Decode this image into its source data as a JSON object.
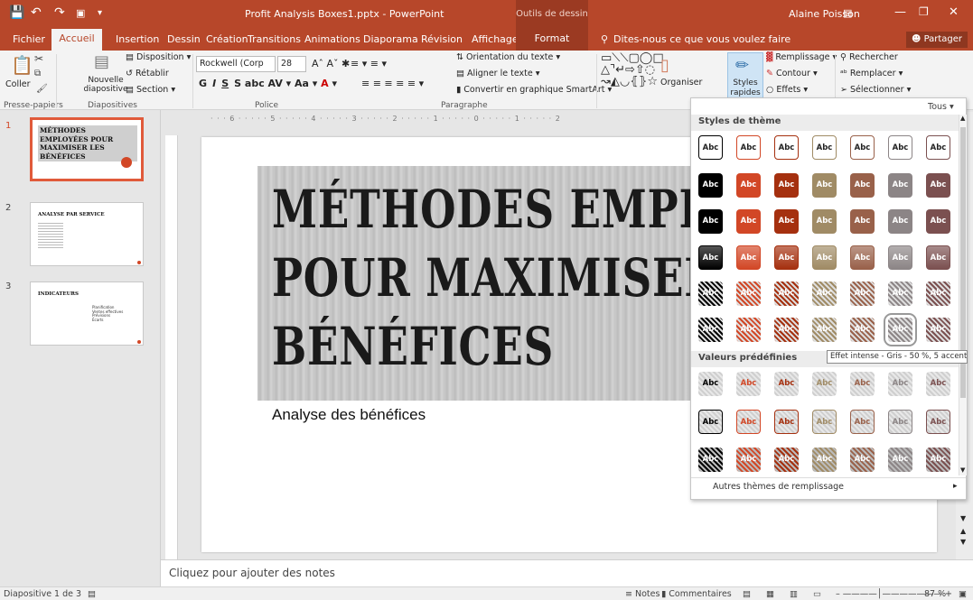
{
  "titlebar": {
    "doc_title": "Profit Analysis Boxes1.pptx - PowerPoint",
    "context_tab": "Outils de dessin",
    "user": "Alaine Poisson"
  },
  "tabs": [
    "Fichier",
    "Accueil",
    "Insertion",
    "Dessin",
    "Création",
    "Transitions",
    "Animations",
    "Diaporama",
    "Révision",
    "Affichage",
    "Format"
  ],
  "active_tab": "Accueil",
  "tell_me": "Dites-nous ce que vous voulez faire",
  "share_label": "Partager",
  "ribbon": {
    "clipboard": {
      "paste": "Coller",
      "group": "Presse-papiers"
    },
    "slides": {
      "new_slide": "Nouvelle diapositive",
      "layout": "Disposition",
      "reset": "Rétablir",
      "section": "Section",
      "group": "Diapositives"
    },
    "font": {
      "name": "Rockwell (Corp",
      "size": "28",
      "group": "Police"
    },
    "paragraph": {
      "text_direction": "Orientation du texte",
      "align_text": "Aligner le texte",
      "smartart": "Convertir en graphique SmartArt",
      "group": "Paragraphe"
    },
    "drawing": {
      "arrange": "Organiser",
      "quick_styles": "Styles rapides",
      "fill": "Remplissage",
      "outline": "Contour",
      "effects": "Effets"
    },
    "editing": {
      "find": "Rechercher",
      "replace": "Remplacer",
      "select": "Sélectionner"
    }
  },
  "thumbnails": [
    {
      "num": "1",
      "title": "MÉTHODES EMPLOYÉES POUR MAXIMISER LES BÉNÉFICES",
      "selected": true
    },
    {
      "num": "2",
      "title": "ANALYSE PAR SERVICE",
      "selected": false
    },
    {
      "num": "3",
      "title": "INDICATEURS",
      "selected": false,
      "bullets": [
        "Planification",
        "Ventes effectives",
        "Prévisions",
        "Écarts"
      ]
    }
  ],
  "slide": {
    "title_lines": [
      "MÉTHODES EMPLO",
      "POUR MAXIMISER",
      "BÉNÉFICES"
    ],
    "subtitle": "Analyse des bénéfices"
  },
  "notes_placeholder": "Cliquez pour ajouter des notes",
  "gallery": {
    "filter": "Tous",
    "section_theme": "Styles de thème",
    "section_presets": "Valeurs prédéfinies",
    "more_fills": "Autres thèmes de remplissage",
    "swatch_label": "Abc",
    "colors": [
      "#000000",
      "#d24726",
      "#a5300f",
      "#a08b65",
      "#99614a",
      "#8c8586",
      "#7b5050"
    ],
    "tooltip": "Effet intense - Gris - 50 %, 5 accentué"
  },
  "status": {
    "slide_info": "Diapositive 1 de 3",
    "notes": "Notes",
    "comments": "Commentaires",
    "zoom": "87 %"
  }
}
